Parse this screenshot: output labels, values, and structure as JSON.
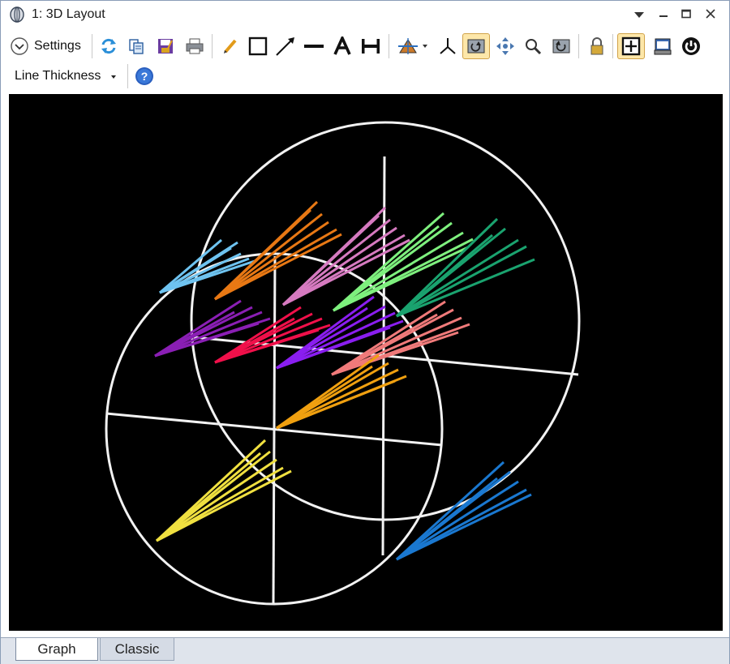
{
  "window": {
    "title": "1: 3D Layout",
    "controls": [
      "dropdown-caret",
      "minimize",
      "maximize",
      "close"
    ]
  },
  "toolbar": {
    "settings_label": "Settings",
    "line_thickness_label": "Line Thickness",
    "icons": [
      "settings-chevron-icon",
      "refresh-icon",
      "copy-icon",
      "save-icon",
      "print-icon",
      "pencil-icon",
      "rectangle-icon",
      "arrow-icon",
      "line-icon",
      "text-icon",
      "dimension-icon",
      "rotate-view-icon",
      "axes-icon",
      "rotate-tool-icon",
      "pan-icon",
      "zoom-icon",
      "reset-view-icon",
      "lock-icon",
      "fit-window-icon",
      "window-icon",
      "power-icon",
      "help-icon"
    ],
    "active_tools": [
      "rotate-tool-icon",
      "fit-window-icon"
    ]
  },
  "canvas": {
    "background": "#000000",
    "beam_colors": [
      "#6ec3f0",
      "#e87814",
      "#d67ac0",
      "#7ef07e",
      "#1aa36f",
      "#8a1fb4",
      "#f0104a",
      "#8a1ef0",
      "#f07a7a",
      "#f0a010",
      "#f0e040",
      "#1a78d0"
    ]
  },
  "tabs": [
    {
      "label": "Graph",
      "active": true
    },
    {
      "label": "Classic",
      "active": false
    }
  ]
}
